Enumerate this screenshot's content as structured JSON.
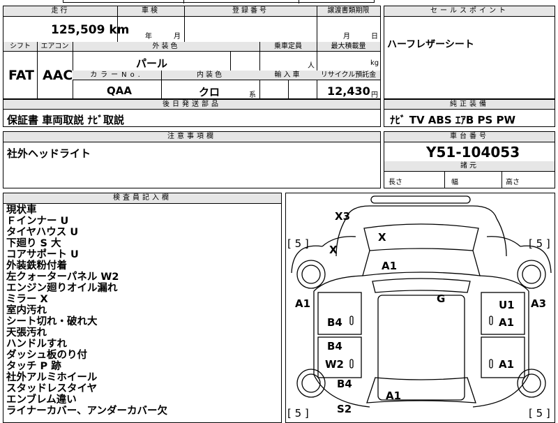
{
  "top_partial": "",
  "mileage": {
    "label": "走行",
    "value": "125,509",
    "unit": "km"
  },
  "shaken": {
    "label": "車検",
    "year_unit": "年",
    "month_unit": "月"
  },
  "registration": {
    "label": "登録番号",
    "value": ""
  },
  "transfer_deadline": {
    "label": "譲渡書類期限",
    "month_unit": "月",
    "day_unit": "日"
  },
  "shift": {
    "label": "シフト",
    "value": "FAT"
  },
  "aircon": {
    "label": "エアコン",
    "value": "AAC"
  },
  "exterior_color": {
    "label": "外装色",
    "value": "パール"
  },
  "color_no": {
    "label": "カラーNo.",
    "value": "QAA"
  },
  "interior_color": {
    "label": "内装色",
    "value": "クロ",
    "suffix": "系"
  },
  "capacity": {
    "label": "乗車定員",
    "unit": "人"
  },
  "max_load": {
    "label": "最大積載量",
    "unit": "kg"
  },
  "import": {
    "label": "輸入車",
    "value": ""
  },
  "recycle": {
    "label": "リサイクル預託金",
    "value": "12,430",
    "unit": "円"
  },
  "later_parts": {
    "label": "後日発送部品",
    "value": "保証書 車両取説 ﾅﾋﾞ取説"
  },
  "sales_point": {
    "label": "セールスポイント",
    "value": "ハーフレザーシート"
  },
  "equipment": {
    "label": "純正装備",
    "value": "ﾅﾋﾞ TV ABS ｴｱB PS PW"
  },
  "caution": {
    "label": "注意事項欄",
    "value": "社外ヘッドライト"
  },
  "chassis": {
    "label": "車台番号",
    "value": "Y51-104053"
  },
  "dimensions": {
    "label": "諸元",
    "length": "長さ",
    "width": "幅",
    "height": "高さ"
  },
  "inspector": {
    "label": "検査員記入欄",
    "notes": [
      "現状車",
      "Ｆインナー U",
      "タイヤハウス U",
      "下廻り S 大",
      "コアサポート U",
      "外装鉄粉付着",
      "左クォーターパネル W2",
      "エンジン廻りオイル漏れ",
      "ミラー X",
      "室内汚れ",
      "シート切れ・破れ大",
      "天張汚れ",
      "ハンドルすれ",
      "ダッシュ板のり付",
      "タッチ P 跡",
      "社外アルミホイール",
      "スタッドレスタイヤ",
      "エンブレム違い",
      "ライナーカバー、アンダーカバー欠"
    ]
  },
  "diagram": {
    "tire_marks": [
      "[ 5 ]",
      "[ 5 ]",
      "[ 5 ]",
      "[ 5 ]"
    ],
    "damage": [
      "X3",
      "X",
      "X",
      "A1",
      "A1",
      "G",
      "U1",
      "A3",
      "A1",
      "B4",
      "B4",
      "W2",
      "A1",
      "B4",
      "A1",
      "S2"
    ]
  }
}
